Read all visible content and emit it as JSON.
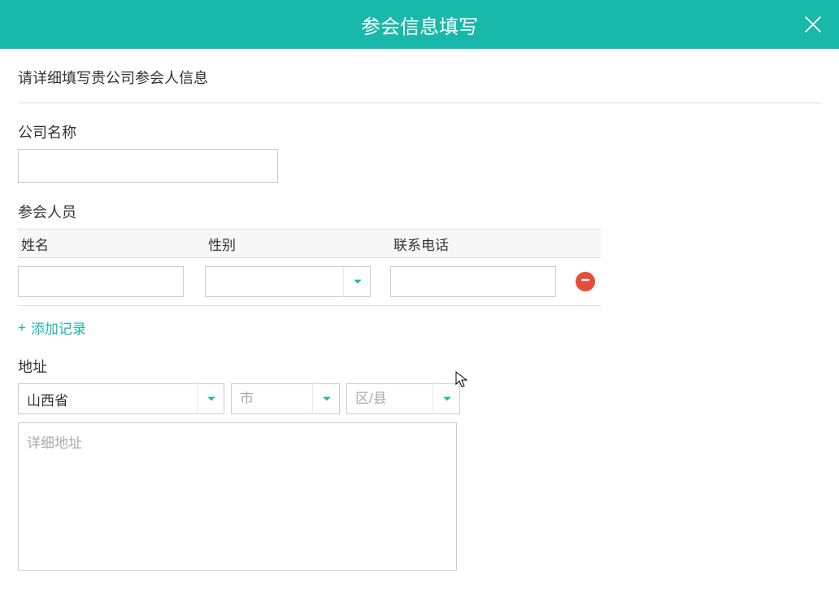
{
  "header": {
    "title": "参会信息填写"
  },
  "intro": "请详细填写贵公司参会人信息",
  "company": {
    "label": "公司名称",
    "value": ""
  },
  "attendees": {
    "label": "参会人员",
    "columns": {
      "name": "姓名",
      "gender": "性别",
      "phone": "联系电话"
    },
    "rows": [
      {
        "name": "",
        "gender": "",
        "phone": ""
      }
    ],
    "add_label": "添加记录"
  },
  "address": {
    "label": "地址",
    "province": {
      "value": "山西省"
    },
    "city": {
      "placeholder": "市",
      "value": ""
    },
    "district": {
      "placeholder": "区/县",
      "value": ""
    },
    "detail": {
      "placeholder": "详细地址",
      "value": ""
    }
  },
  "colors": {
    "primary": "#18B9AB",
    "danger": "#E74C3C"
  }
}
